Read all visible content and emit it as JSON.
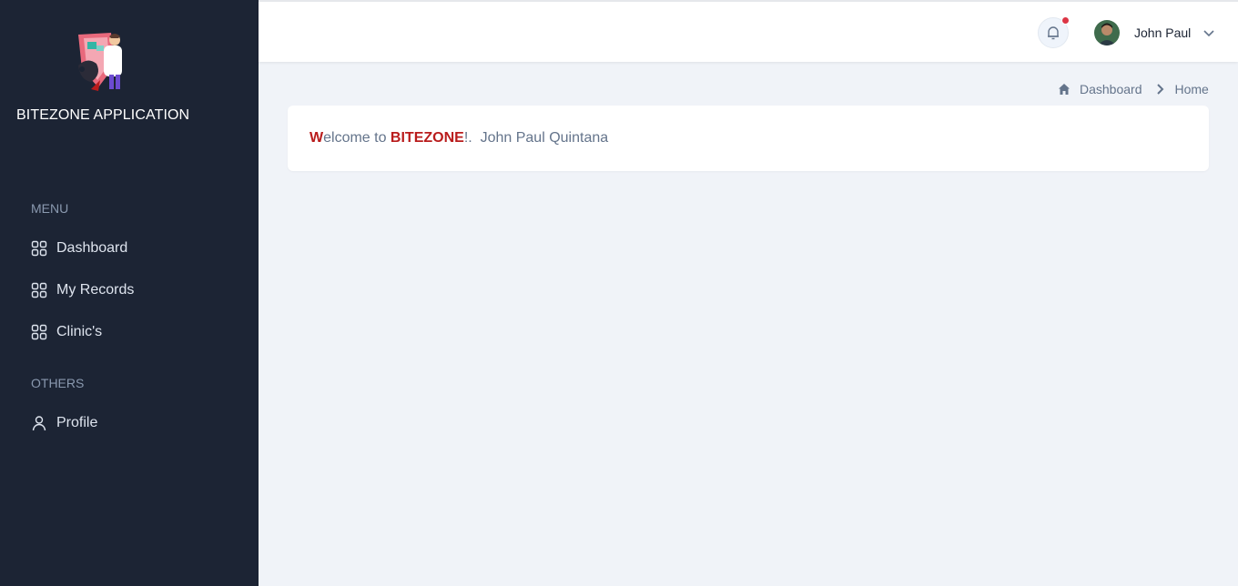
{
  "sidebar": {
    "brand": "BITEZONE APPLICATION",
    "menu_title": "MENU",
    "menu_items": [
      {
        "label": "Dashboard",
        "icon": "grid-icon"
      },
      {
        "label": "My Records",
        "icon": "grid-icon"
      },
      {
        "label": "Clinic's",
        "icon": "grid-icon"
      }
    ],
    "others_title": "OTHERS",
    "others_items": [
      {
        "label": "Profile",
        "icon": "user-icon"
      }
    ]
  },
  "header": {
    "user_name": "John Paul",
    "notification_icon": "bell-icon",
    "dropdown_icon": "chevron-down-icon"
  },
  "breadcrumb": {
    "items": [
      "Dashboard",
      "Home"
    ]
  },
  "welcome": {
    "first_letter": "W",
    "greeting_rest": "elcome to ",
    "app_name": "BITEZONE",
    "punct": "!.  ",
    "full_name": "John Paul Quintana"
  },
  "colors": {
    "sidebar_bg": "#1c2434",
    "page_bg": "#f0f3f8",
    "accent_red": "#b91c1c",
    "notification_dot": "#dc3545"
  }
}
